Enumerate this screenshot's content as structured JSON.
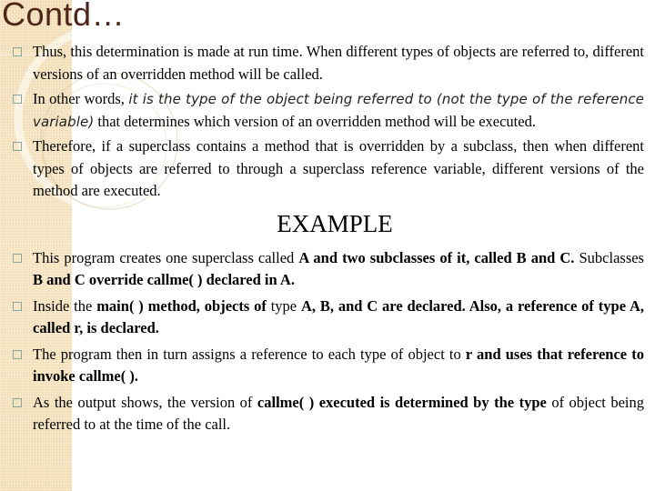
{
  "slide": {
    "title": "Contd…",
    "accent_colors": {
      "title": "#4e2419",
      "side_strip": "#f3dfb7",
      "bullet_outline": "#8aa39b"
    },
    "bullet_icon": "hollow-square",
    "intro_points": [
      {
        "segments": [
          {
            "text": "Thus, this determination is made at run time. When different types of objects are referred to, different versions of an overridden method will be called.",
            "style": "normal"
          }
        ]
      },
      {
        "segments": [
          {
            "text": "In other words, ",
            "style": "normal"
          },
          {
            "text": "it is the type of the object being referred to (not the type of the reference variable)",
            "style": "italic"
          },
          {
            "text": " that determines which version of an overridden method will be executed.",
            "style": "normal"
          }
        ]
      },
      {
        "segments": [
          {
            "text": "Therefore, if a superclass contains a method that is overridden by a subclass, then when different types of objects are referred to through a superclass reference variable, different versions of the method are executed.",
            "style": "normal"
          }
        ]
      }
    ],
    "example_heading": "EXAMPLE",
    "example_points": [
      {
        "segments": [
          {
            "text": "This program creates one superclass called ",
            "style": "normal"
          },
          {
            "text": "A and two subclasses of it, called B and C.",
            "style": "bold"
          },
          {
            "text": " Subclasses ",
            "style": "normal"
          },
          {
            "text": "B and C override callme( ) declared in A.",
            "style": "bold"
          }
        ]
      },
      {
        "segments": [
          {
            "text": "Inside the ",
            "style": "normal"
          },
          {
            "text": "main( ) method, objects of",
            "style": "bold"
          },
          {
            "text": " type ",
            "style": "normal"
          },
          {
            "text": "A, B, and C are declared. Also, a reference of type A, called r, is declared.",
            "style": "bold"
          }
        ]
      },
      {
        "segments": [
          {
            "text": "The program then in turn assigns a reference to each type of object to ",
            "style": "normal"
          },
          {
            "text": "r and uses that reference to invoke callme( ).",
            "style": "bold"
          }
        ]
      },
      {
        "segments": [
          {
            "text": "As the output shows, the version of ",
            "style": "normal"
          },
          {
            "text": "callme( ) executed is determined by the type",
            "style": "bold"
          },
          {
            "text": " of object being referred to at the time of the call.",
            "style": "normal"
          }
        ]
      }
    ]
  }
}
